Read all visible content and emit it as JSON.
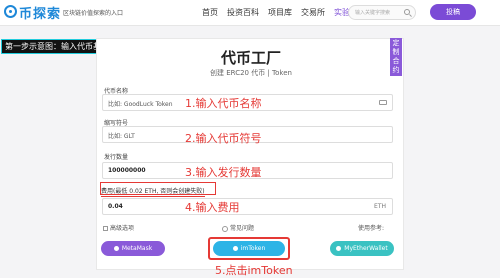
{
  "header": {
    "logo_text": "币探索",
    "slogan": "区块链价值探索的入口",
    "nav": [
      {
        "label": "首页",
        "active": false
      },
      {
        "label": "投资百科",
        "active": false
      },
      {
        "label": "项目库",
        "active": false
      },
      {
        "label": "交易所",
        "active": false
      },
      {
        "label": "实验室",
        "active": true
      }
    ],
    "search_placeholder": "输入关键字搜索",
    "post_button": "投稿"
  },
  "overlay_title": "第一步示意图：输入代币基本信息",
  "card": {
    "title": "代币工厂",
    "subtitle": "创建 ERC20 代币 | Token",
    "side_tab": "定制合约"
  },
  "form": {
    "name_label": "代币名称",
    "name_placeholder": "比如: GoodLuck Token",
    "symbol_label": "缩写符号",
    "symbol_placeholder": "比如: GLT",
    "supply_label": "发行数量",
    "supply_value": "100000000",
    "fee_label": "费用(最低 0.02 ETH, 否则会创建失败)",
    "fee_value": "0.04",
    "fee_unit": "ETH",
    "advanced": "高级选项",
    "faq": "常见问题",
    "reference": "使用参考:"
  },
  "annotations": {
    "step1": "1.输入代币名称",
    "step2": "2.输入代币符号",
    "step3": "3.输入发行数量",
    "step4": "4.输入费用",
    "step5": "5.点击imToken"
  },
  "wallets": {
    "metamask": "MetaMask",
    "imtoken": "imToken",
    "myetherwallet": "MyEtherWallet"
  },
  "colors": {
    "brand_blue": "#1e88d8",
    "accent_purple": "#7b4bd6",
    "annotation_red": "#e53935",
    "imtoken_blue": "#2db4e6",
    "myether_teal": "#3ac2c2"
  }
}
